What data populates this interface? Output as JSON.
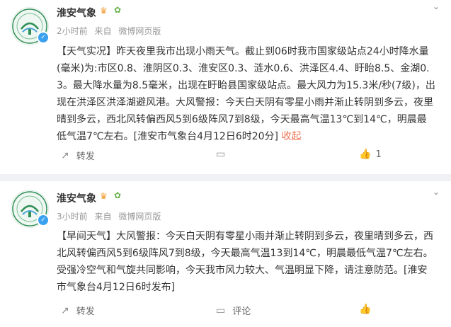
{
  "posts": [
    {
      "author": "淮安气象",
      "time": "2小时前",
      "source_prefix": "来自",
      "source": "微博网页版",
      "content": "【天气实况】昨天夜里我市出现小雨天气。截止到06时我市国家级站点24小时降水量(毫米)为:市区0.8、淮阴区0.3、淮安区0.3、涟水0.6、洪泽区4.4、盱眙8.5、金湖0.3。最大降水量为8.5毫米，出现在盱眙县国家级站点。最大风力为15.3米/秒(7级)，出现在洪泽区洪泽湖避风港。大风警报：今天白天阴有零星小雨并渐止转阴到多云，夜里晴到多云，西北风转偏西风5到6级阵风7到8级，今天最高气温13℃到14℃，明晨最低气温7℃左右。[淮安市气象台4月12日6时20分]",
      "collapse_label": "收起",
      "repost_label": "转发",
      "comment_label": "",
      "like_count": "1"
    },
    {
      "author": "淮安气象",
      "time": "3小时前",
      "source_prefix": "来自",
      "source": "微博网页版",
      "content": "【早间天气】大风警报：今天白天阴有零星小雨并渐止转阴到多云，夜里晴到多云，西北风转偏西风5到6级阵风7到8级，今天最高气温13到14℃，明晨最低气温7℃左右。受强冷空气和气旋共同影响，今天我市风力较大、气温明显下降，请注意防范。[淮安市气象台4月12日6时发布]",
      "repost_label": "转发",
      "comment_label": "评论",
      "like_count": ""
    }
  ],
  "icons": {
    "crown": "crown-icon",
    "sprout": "sprout-icon",
    "verified": "verified-icon",
    "chevron": "chevron-down-icon",
    "repost": "repost-icon",
    "comment": "comment-icon",
    "like": "like-icon"
  },
  "colors": {
    "accent": "#eb7350",
    "verified": "#3aa0f0",
    "meta": "#999999"
  }
}
